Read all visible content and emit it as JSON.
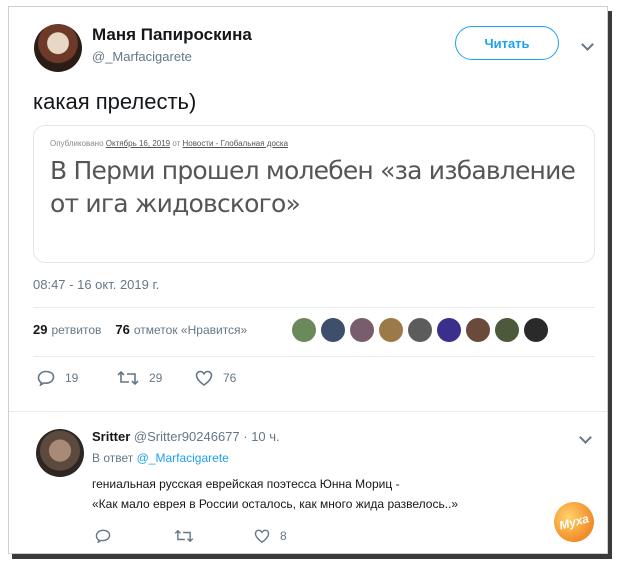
{
  "tweet": {
    "author_name": "Маня Папироскина",
    "author_handle": "@_Marfacigarete",
    "follow_label": "Читать",
    "text": "какая прелесть)",
    "card": {
      "meta_prefix": "Опубликовано ",
      "meta_date": "Октябрь 16, 2019",
      "meta_mid": " от ",
      "meta_source": "Новости - Глобальная доска",
      "title": "В Перми прошел молебен «за избавление от ига жидовского»"
    },
    "timestamp": "08:47 - 16 окт. 2019 г.",
    "retweets_count": "29",
    "retweets_label": "ретвитов",
    "likes_count": "76",
    "likes_label": "отметок «Нравится»",
    "actions": {
      "replies": "19",
      "retweets": "29",
      "likes": "76"
    },
    "liker_colors": [
      "#6b8a5a",
      "#3d4f6a",
      "#7a5d6c",
      "#9c7a48",
      "#5c5c5c",
      "#3a2f8a",
      "#6a4a3a",
      "#4a5a3a",
      "#2a2a2a"
    ]
  },
  "reply": {
    "author_name": "Sritter",
    "author_handle": "@Sritter90246677",
    "time": "· 10 ч.",
    "reply_to_prefix": "В ответ",
    "reply_to_mention": "@_Marfacigarete",
    "line1": "гениальная русская еврейская поэтесса Юнна Мориц -",
    "line2": "«Как мало еврея в России осталось, как много жида развелось..»",
    "actions": {
      "replies": "",
      "retweets": "",
      "likes": "8"
    }
  },
  "watermark": "Муха"
}
